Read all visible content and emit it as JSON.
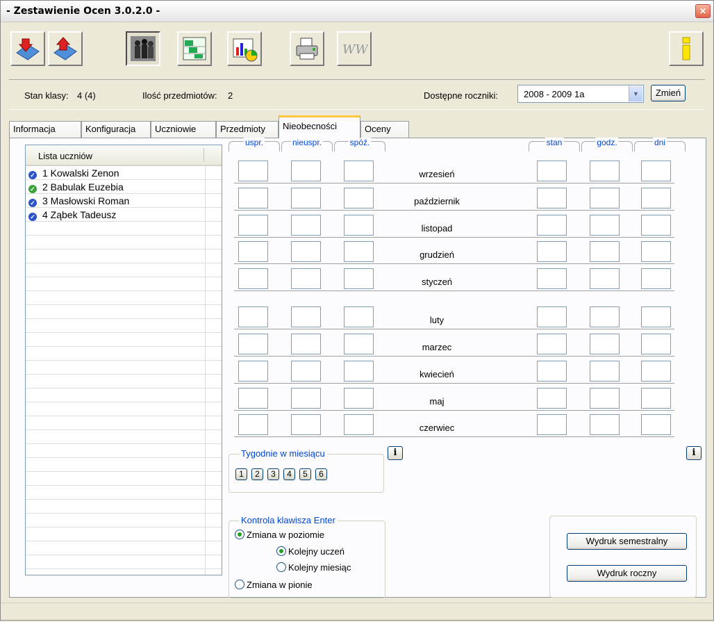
{
  "window": {
    "title": "- Zestawienie Ocen 3.0.2.0 -",
    "close_icon": "close-icon"
  },
  "toolbar": {
    "buttons": [
      {
        "name": "import-icon"
      },
      {
        "name": "export-icon"
      },
      {
        "name": "students-icon",
        "pressed": true
      },
      {
        "name": "grades-sheet-icon"
      },
      {
        "name": "statistics-chart-icon"
      },
      {
        "name": "printer-icon"
      },
      {
        "name": "www-icon"
      },
      {
        "name": "info-icon"
      }
    ]
  },
  "info": {
    "class_state_label": "Stan klasy:",
    "class_state_value": "4 (4)",
    "subjects_label": "Ilość przedmiotów:",
    "subjects_value": "2",
    "years_label": "Dostępne roczniki:",
    "years_value": "2008 - 2009  1a",
    "change_button": "Zmień"
  },
  "tabs": [
    "Informacja",
    "Konfiguracja",
    "Uczniowie",
    "Przedmioty",
    "Nieobecności",
    "Oceny"
  ],
  "active_tab": "Nieobecności",
  "students": {
    "header": "Lista uczniów",
    "items": [
      {
        "label": "1  Kowalski Zenon",
        "status": "blue"
      },
      {
        "label": "2  Babulak Euzebia",
        "status": "green"
      },
      {
        "label": "3  Masłowski Roman",
        "status": "blue"
      },
      {
        "label": "4  Ząbek Tadeusz",
        "status": "blue"
      }
    ]
  },
  "absences": {
    "left_columns": [
      "uspr.",
      "nieuspr.",
      "spóź."
    ],
    "right_columns": [
      "stan",
      "godz.",
      "dni"
    ],
    "months": [
      "wrzesień",
      "październik",
      "listopad",
      "grudzień",
      "styczeń",
      "luty",
      "marzec",
      "kwiecień",
      "maj",
      "czerwiec"
    ]
  },
  "weeks": {
    "label": "Tygodnie w miesiącu",
    "buttons": [
      "1",
      "2",
      "3",
      "4",
      "5",
      "6"
    ]
  },
  "enter_control": {
    "label": "Kontrola klawisza Enter",
    "horizontal": "Zmiana w poziomie",
    "next_student": "Kolejny uczeń",
    "next_month": "Kolejny miesiąc",
    "vertical": "Zmiana w pionie"
  },
  "print": {
    "semester": "Wydruk semestralny",
    "yearly": "Wydruk roczny"
  },
  "info_button_label": "i"
}
